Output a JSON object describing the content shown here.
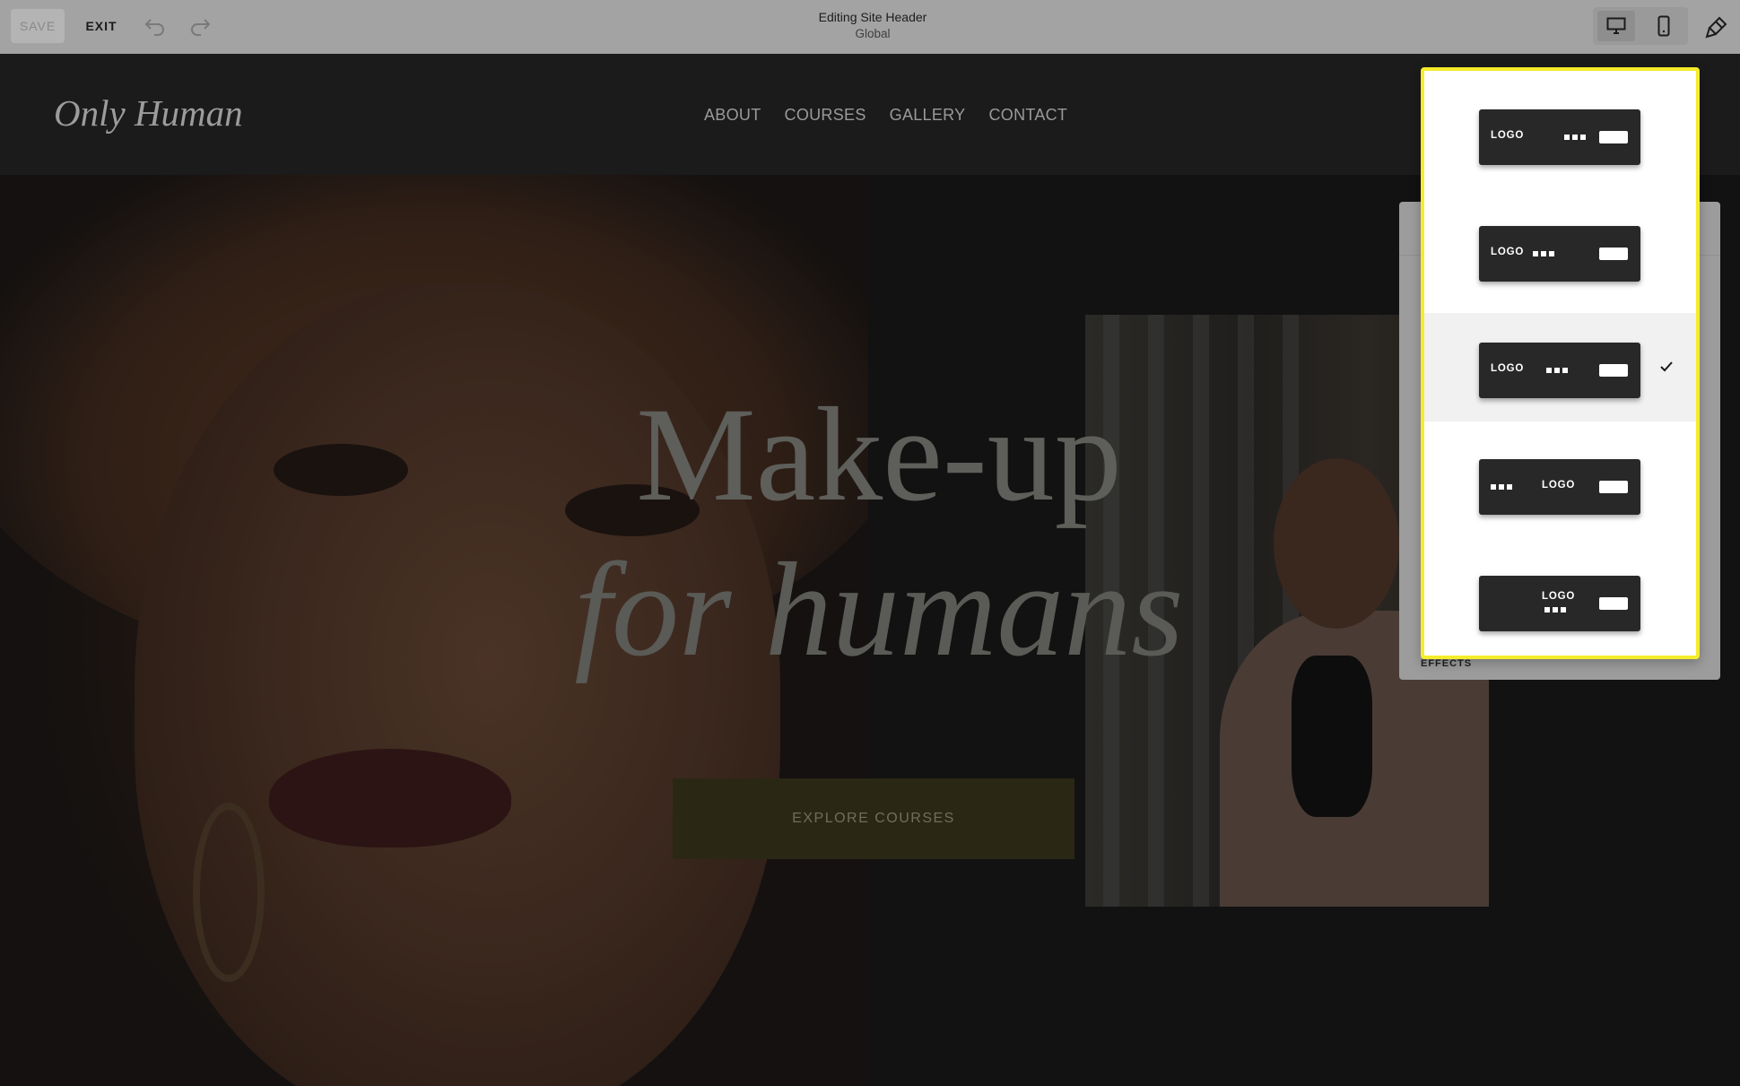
{
  "toolbar": {
    "save_label": "SAVE",
    "exit_label": "EXIT",
    "undo_icon": "undo-icon",
    "redo_icon": "redo-icon",
    "editing_title": "Editing Site Header",
    "editing_scope": "Global",
    "device_options": [
      "desktop-icon",
      "mobile-icon"
    ],
    "selected_device": "desktop",
    "design_icon": "paintbrush-icon"
  },
  "site": {
    "logo": "Only Human",
    "nav": [
      "ABOUT",
      "COURSES",
      "GALLERY",
      "CONTACT"
    ],
    "headline_line1": "Make-up",
    "headline_line2": "for humans",
    "cta_label": "EXPLORE COURSES"
  },
  "panel": {
    "effects_label": "EFFECTS"
  },
  "layout_popover": {
    "accent_color": "#f5ec2a",
    "selected_index": 2,
    "options": [
      {
        "logo_text": "LOGO",
        "arrangement": "logo-left, nav-right, button-right"
      },
      {
        "logo_text": "LOGO",
        "arrangement": "logo-left, nav-left, button-right"
      },
      {
        "logo_text": "LOGO",
        "arrangement": "logo-left, nav-center, button-right"
      },
      {
        "logo_text": "LOGO",
        "arrangement": "nav-left, logo-center, button-right"
      },
      {
        "logo_text": "LOGO",
        "arrangement": "logo-center, nav-below, button-right"
      }
    ]
  }
}
